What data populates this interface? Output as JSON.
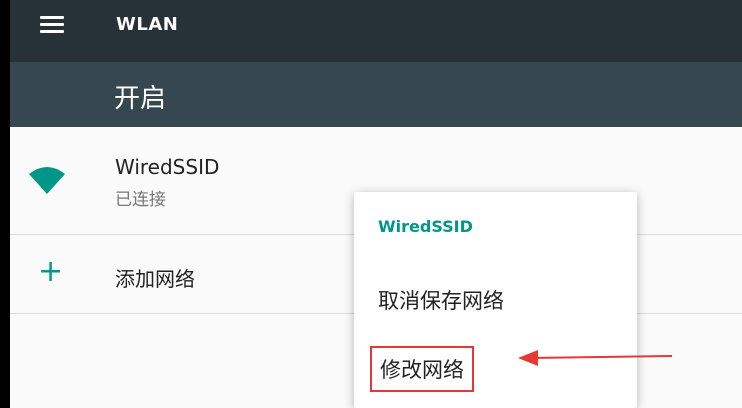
{
  "toolbar": {
    "title": "WLAN",
    "menu_icon": "hamburger-menu-icon"
  },
  "switch": {
    "label": "开启"
  },
  "networks": [
    {
      "name": "WiredSSID",
      "status": "已连接",
      "icon": "wifi-signal-icon"
    }
  ],
  "add_network": {
    "label": "添加网络",
    "icon": "plus-icon"
  },
  "context_menu": {
    "title": "WiredSSID",
    "items": [
      {
        "label": "取消保存网络"
      },
      {
        "label": "修改网络"
      }
    ]
  },
  "colors": {
    "toolbar": "#263238",
    "switch_bar": "#37474f",
    "accent": "#009688",
    "highlight": "#e53935"
  }
}
